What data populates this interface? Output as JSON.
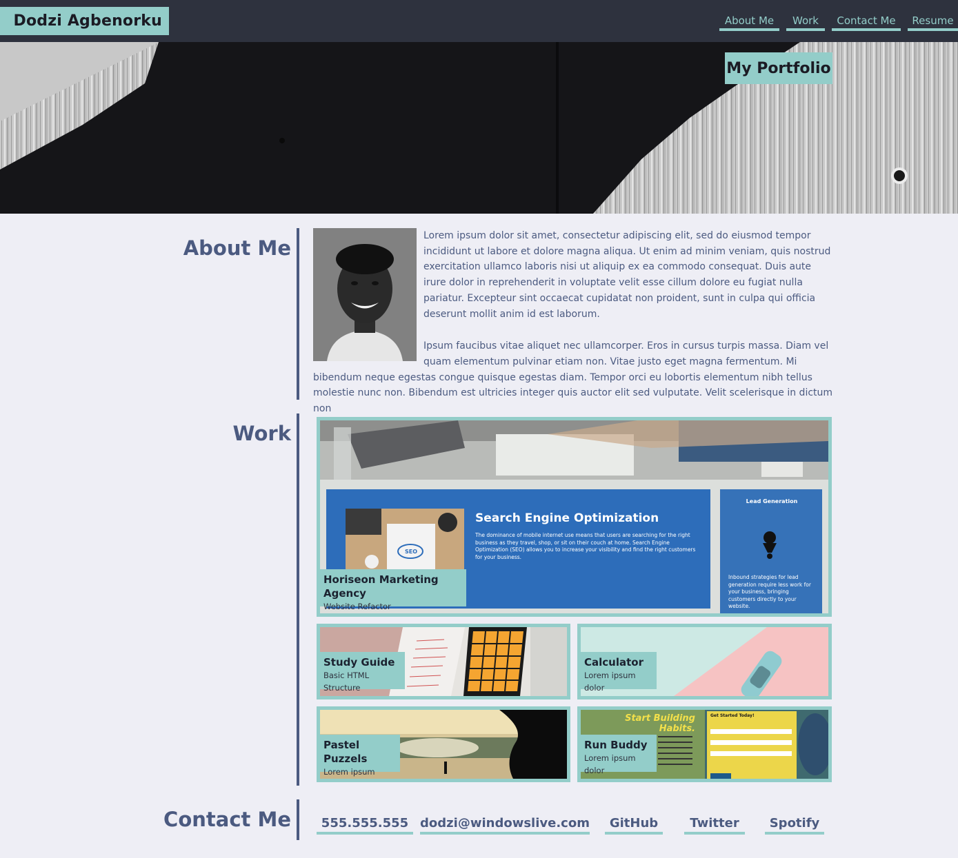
{
  "header": {
    "brand": "Dodzi Agbenorku",
    "nav": [
      "About Me",
      "Work",
      "Contact Me",
      "Resume"
    ]
  },
  "hero": {
    "title": "My Portfolio"
  },
  "about": {
    "heading": "About Me",
    "paragraphs": [
      "Lorem ipsum dolor sit amet, consectetur adipiscing elit, sed do eiusmod tempor incididunt ut labore et dolore magna aliqua. Ut enim ad minim veniam, quis nostrud exercitation ullamco laboris nisi ut aliquip ex ea commodo consequat. Duis aute irure dolor in reprehenderit in voluptate velit esse cillum dolore eu fugiat nulla pariatur. Excepteur sint occaecat cupidatat non proident, sunt in culpa qui officia deserunt mollit anim id est laborum.",
      "Ipsum faucibus vitae aliquet nec ullamcorper. Eros in cursus turpis massa. Diam vel quam elementum pulvinar etiam non. Vitae justo eget magna fermentum. Mi bibendum neque egestas congue quisque egestas diam. Tempor orci eu lobortis elementum nibh tellus molestie nunc non. Bibendum est ultricies integer quis auctor elit sed vulputate. Velit scelerisque in dictum non"
    ]
  },
  "work": {
    "heading": "Work",
    "featured": {
      "title": "Horiseon Marketing Agency",
      "subtitle": "Website Refactor",
      "screenshot": {
        "seo_title": "Search Engine Optimization",
        "seo_body": "The dominance of mobile internet use means that users are searching for the right business as they travel, shop, or sit on their couch at home. Search Engine Optimization (SEO) allows you to increase your visibility and find the right customers for your business.",
        "lead_title": "Lead Generation",
        "lead_body": "Inbound strategies for lead generation require less work for your business, bringing customers directly to your website.",
        "seo_badge": "SEO"
      }
    },
    "projects": [
      {
        "title": "Study Guide",
        "subtitle": "Basic HTML Structure"
      },
      {
        "title": "Calculator",
        "subtitle": "Lorem ipsum dolor"
      },
      {
        "title": "Pastel Puzzels",
        "subtitle": "Lorem ipsum dolor"
      },
      {
        "title": "Run Buddy",
        "subtitle": "Lorem ipsum dolor",
        "banner": "Start Building Habits.",
        "form_title": "Get Started Today!"
      }
    ]
  },
  "contact": {
    "heading": "Contact Me",
    "items": [
      "555.555.555",
      "dodzi@windowslive.com",
      "GitHub",
      "Twitter",
      "Spotify"
    ]
  },
  "colors": {
    "accent": "#93cdc9",
    "header_bg": "#2e323e",
    "text": "#4b5a80",
    "page_bg": "#eeeef5"
  }
}
